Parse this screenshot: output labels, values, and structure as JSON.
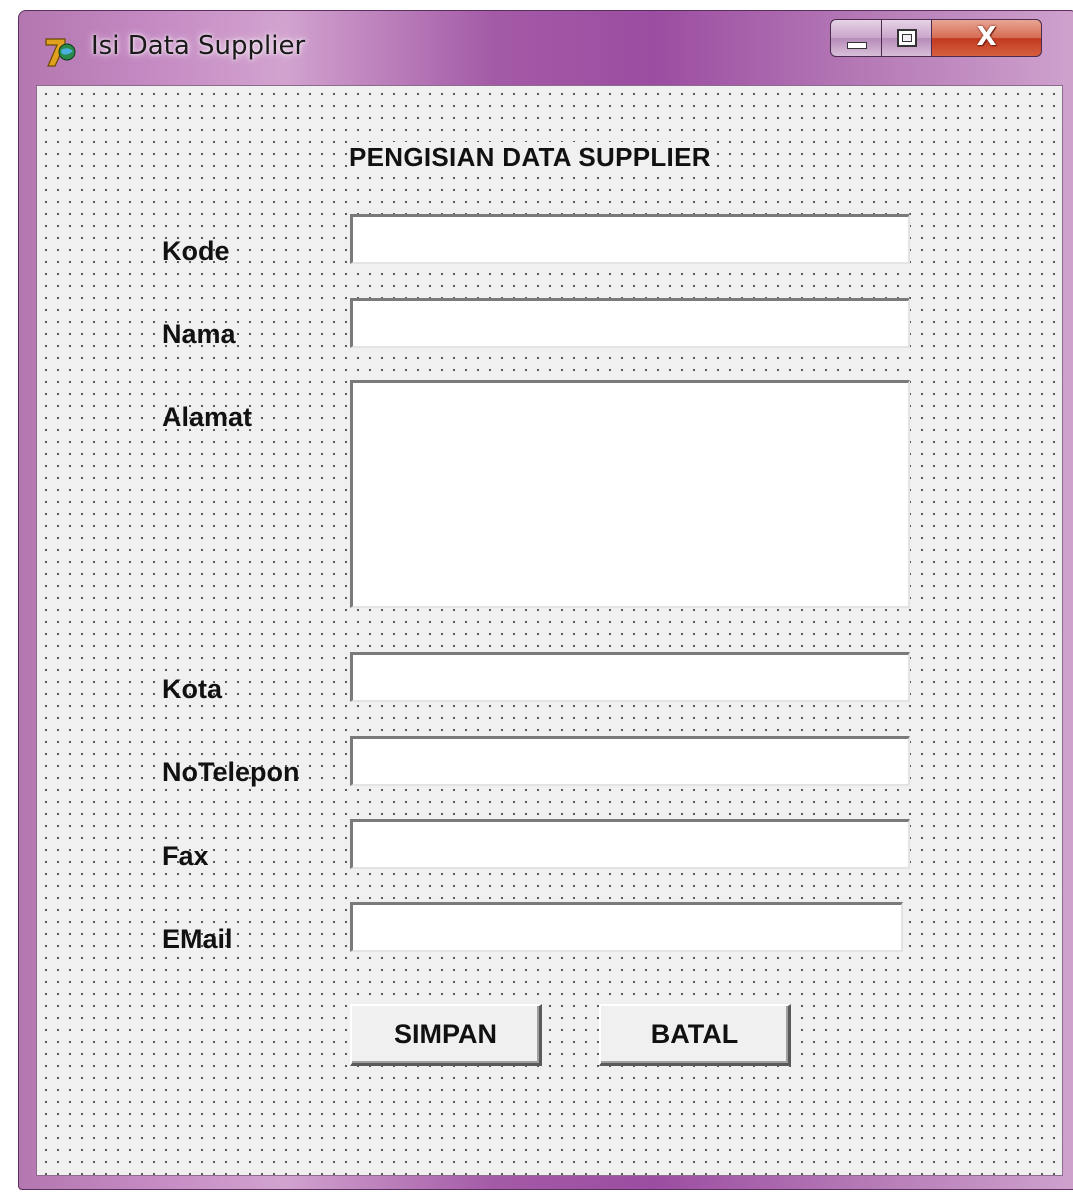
{
  "window": {
    "title": "Isi Data Supplier",
    "icon": "app-icon",
    "controls": {
      "minimize": "minimize-icon",
      "maximize": "maximize-icon",
      "close_label": "X"
    }
  },
  "form": {
    "heading": "PENGISIAN DATA SUPPLIER",
    "fields": {
      "kode": {
        "label": "Kode",
        "value": ""
      },
      "nama": {
        "label": "Nama",
        "value": ""
      },
      "alamat": {
        "label": "Alamat",
        "value": ""
      },
      "kota": {
        "label": "Kota",
        "value": ""
      },
      "notelepon": {
        "label": "NoTelepon",
        "value": ""
      },
      "fax": {
        "label": "Fax",
        "value": ""
      },
      "email": {
        "label": "EMail",
        "value": ""
      }
    },
    "buttons": {
      "save": "SIMPAN",
      "cancel": "BATAL"
    }
  },
  "colors": {
    "title_bar": "#a35aa6",
    "client_bg": "#f0f0f0",
    "close_button": "#c2391f"
  }
}
